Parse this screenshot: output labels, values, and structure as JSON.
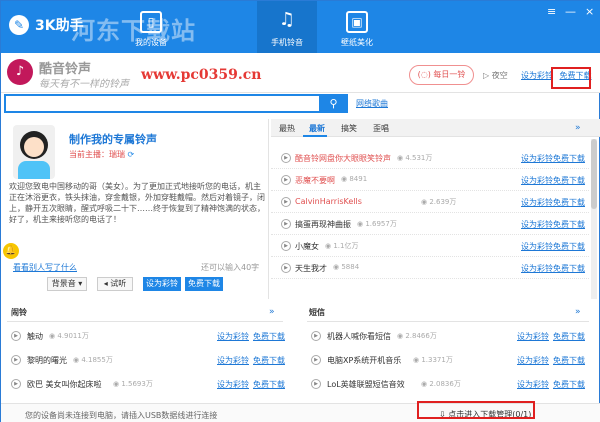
{
  "app": {
    "name": "3K助手",
    "watermark": "河东下载站"
  },
  "nav": {
    "tabs": [
      {
        "label": "我的设备"
      },
      {
        "label": "手机铃音"
      },
      {
        "label": "壁纸美化"
      }
    ]
  },
  "window": {
    "close": "×",
    "minimize": "—",
    "settings": "≡"
  },
  "banner": {
    "title": "酷音铃声",
    "slogan": "每天有不一样的铃声",
    "url": "www.pc0359.cn",
    "daily": "每日一铃",
    "night": "夜空",
    "set_ring": "设为彩铃",
    "free_dl": "免费下载"
  },
  "search": {
    "placeholder": "",
    "button": "搜",
    "network": "网络歌曲"
  },
  "make": {
    "title": "制作我的专属铃声",
    "current": "当前主播：瑞瑞",
    "intro": "欢迎您致电中国移动的哥（美女）。为了更加正式地接听您的电话，机主正在沐浴更衣，铁头抹油，穿金戴银，外加穿鞋戴帽。然后对着镜子，闭上，静开五次眼睛，醒式呼吸二十下……终于恢复到了精神饱满的状态，好了，机主来接听您的电话了！",
    "others": "看看别人写了什么",
    "remain": "还可以输入40字",
    "voice": "背景音",
    "listen": "试听",
    "set_ring": "设为彩铃",
    "free_dl": "免费下载"
  },
  "tabs": [
    "最热",
    "最新",
    "搞笑",
    "歪唱"
  ],
  "songs": [
    {
      "name": "酷音铃网盘你大眼眼笑铃声",
      "count": "4.531万",
      "hot": true
    },
    {
      "name": "恶魔不要啊",
      "count": "8491",
      "hot": true
    },
    {
      "name": "CalvinHarrisKells",
      "count": "2.639万",
      "hot": true
    },
    {
      "name": "搞蛋再现神曲振",
      "count": "1.6957万",
      "hot": false
    },
    {
      "name": "小魔女",
      "count": "1.1亿万",
      "hot": false
    },
    {
      "name": "天生我才",
      "count": "5884",
      "hot": false
    }
  ],
  "row_links": {
    "set": "设为彩铃",
    "dl": "免费下载"
  },
  "sections": {
    "left": {
      "title": "闹铃",
      "items": [
        {
          "name": "触动",
          "count": "4.9011万"
        },
        {
          "name": "黎明的曙光",
          "count": "4.1855万"
        },
        {
          "name": "欧巴 美女叫你起床啦",
          "count": "1.5693万"
        }
      ]
    },
    "right": {
      "title": "短信",
      "items": [
        {
          "name": "机器人喊你看短信",
          "count": "2.8466万"
        },
        {
          "name": "电脑XP系统开机音乐",
          "count": "1.3371万"
        },
        {
          "name": "LoL英雄联盟短信音效",
          "count": "2.0836万"
        }
      ]
    }
  },
  "status": {
    "message": "您的设备尚未连接到电脑，请插入USB数据线进行连接",
    "download": "点击进入下载管理(0/1)"
  }
}
